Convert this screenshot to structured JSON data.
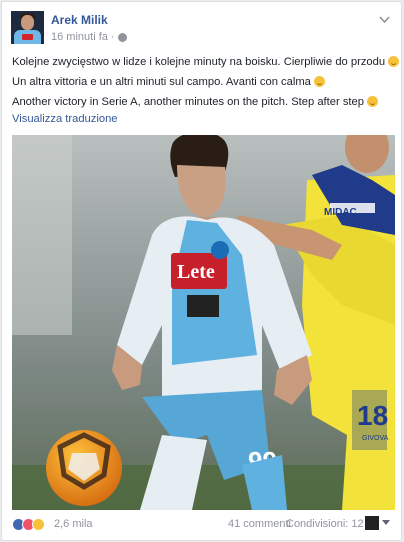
{
  "post": {
    "author": "Arek Milik",
    "time": "16 minuti fa",
    "text_lines": [
      "Kolejne zwycięstwo w lidze i kolejne minuty na boisku. Cierpliwie do przodu",
      "Un altra vittoria e un altri minuti sul campo. Avanti con calma",
      "Another victory in Serie A, another minutes on the pitch. Step after step"
    ],
    "translate_link": "Visualizza traduzione"
  },
  "photo": {
    "shirt_sponsor": "Lete",
    "shirt_number": "99",
    "opponent_sponsor": "MIDAC",
    "opponent_number": "18",
    "opponent_brand": "GIVOVA"
  },
  "footer": {
    "reaction_count": "2,6 mila",
    "comments": "41 commenti",
    "shares": "Condivisioni: 12"
  },
  "colors": {
    "link": "#365899",
    "muted": "#90949c",
    "like": "#4267b2",
    "love": "#f25268",
    "wow": "#f7c23b"
  }
}
